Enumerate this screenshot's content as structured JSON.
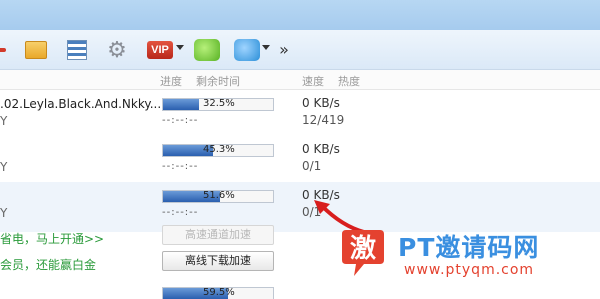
{
  "toolbar": {
    "icons": [
      "folder-icon",
      "list-icon",
      "gear-icon",
      "vip-icon",
      "green-app-icon",
      "blue-app-icon",
      "more-icon"
    ],
    "vip_label": "VIP",
    "more_label": "»"
  },
  "columns": {
    "progress": "进度",
    "remaining": "剩余时间",
    "speed": "速度",
    "health": "热度"
  },
  "rows": [
    {
      "name": ".02.Leyla.Black.And.Nkky....",
      "suffix": "Y",
      "progress_pct": 32.5,
      "progress_label": "32.5%",
      "remaining": "--:--:--",
      "speed": "0 KB/s",
      "count": "12/419"
    },
    {
      "name": "",
      "suffix": "Y",
      "progress_pct": 45.3,
      "progress_label": "45.3%",
      "remaining": "--:--:--",
      "speed": "0 KB/s",
      "count": "0/1"
    },
    {
      "name": "",
      "suffix": "Y",
      "progress_pct": 51.6,
      "progress_label": "51.6%",
      "remaining": "--:--:--",
      "speed": "0 KB/s",
      "count": "0/1"
    },
    {
      "progress_pct": 59.5,
      "progress_label": "59.5%"
    }
  ],
  "promos": {
    "line1": "省电，马上开通>>",
    "line2": "会员，还能赢白金"
  },
  "buttons": {
    "high_speed": "高速通道加速",
    "offline": "离线下载加速"
  },
  "watermark": {
    "logo_char": "激",
    "title": "PT邀请码网",
    "url": "www.ptyqm.com"
  },
  "colors": {
    "accent_blue": "#3a8fe0",
    "progress_fill": "#2a5faf",
    "promo_green": "#2a9a3a",
    "annotation_red": "#d81e1e"
  }
}
